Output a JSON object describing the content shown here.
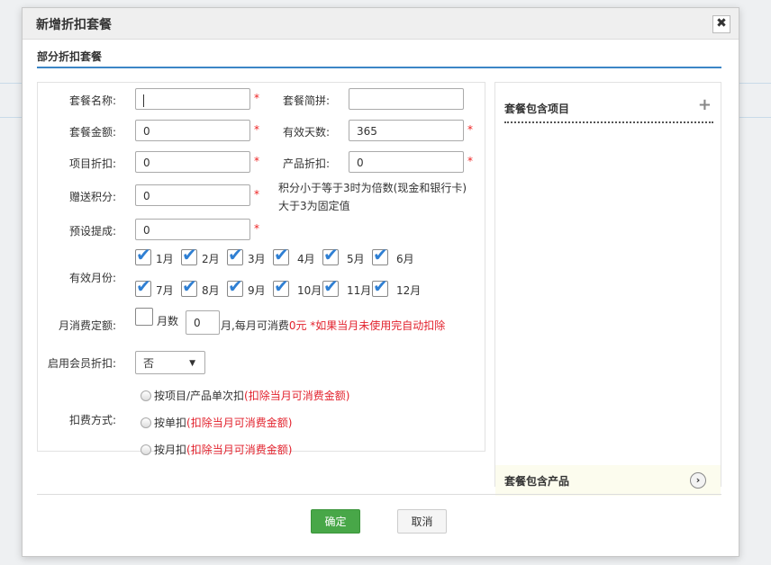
{
  "dialog": {
    "title": "新增折扣套餐",
    "close_glyph": "✖",
    "subtitle": "部分折扣套餐"
  },
  "form": {
    "name": {
      "label": "套餐名称:",
      "value": "",
      "required": "*"
    },
    "short": {
      "label": "套餐简拼:",
      "value": ""
    },
    "amount": {
      "label": "套餐金额:",
      "value": "0",
      "required": "*"
    },
    "days": {
      "label": "有效天数:",
      "value": "365",
      "required": "*"
    },
    "item_discount": {
      "label": "项目折扣:",
      "value": "0",
      "required": "*"
    },
    "product_discount": {
      "label": "产品折扣:",
      "value": "0",
      "required": "*"
    },
    "points": {
      "label": "赠送积分:",
      "value": "0",
      "required": "*",
      "note1": "积分小于等于3时为倍数(现金和银行卡)",
      "note2": "大于3为固定值"
    },
    "commission": {
      "label": "预设提成:",
      "value": "0",
      "required": "*"
    },
    "months_label": "有效月份:",
    "months": [
      {
        "label": "1月",
        "checked": true
      },
      {
        "label": "2月",
        "checked": true
      },
      {
        "label": "3月",
        "checked": true
      },
      {
        "label": "4月",
        "checked": true
      },
      {
        "label": "5月",
        "checked": true
      },
      {
        "label": "6月",
        "checked": true
      },
      {
        "label": "7月",
        "checked": true
      },
      {
        "label": "8月",
        "checked": true
      },
      {
        "label": "9月",
        "checked": true
      },
      {
        "label": "10月",
        "checked": true
      },
      {
        "label": "11月",
        "checked": true
      },
      {
        "label": "12月",
        "checked": true
      }
    ],
    "monthly_quota": {
      "label": "月消费定额:",
      "months_text": "月数",
      "months_value": "0",
      "suffix": "月,每月可消费",
      "amount_text": "0元",
      "warning": "*如果当月未使用完自动扣除"
    },
    "member_discount": {
      "label": "启用会员折扣:",
      "value": "否",
      "arrow": "▼"
    },
    "deduction": {
      "label": "扣费方式:",
      "options": [
        {
          "text": "按项目/产品单次扣",
          "note": "(扣除当月可消费金额)"
        },
        {
          "text": "按单扣",
          "note": "(扣除当月可消费金额)"
        },
        {
          "text": "按月扣",
          "note": "(扣除当月可消费金额)"
        }
      ]
    }
  },
  "side": {
    "items_title": "套餐包含项目",
    "add_glyph": "+",
    "products_title": "套餐包含产品",
    "go_glyph": "›"
  },
  "footer": {
    "confirm": "确定",
    "cancel": "取消"
  },
  "colors": {
    "accent": "#3c86c6",
    "confirm": "#48a748",
    "required": "#e2222d",
    "check": "#2f7fd3"
  }
}
